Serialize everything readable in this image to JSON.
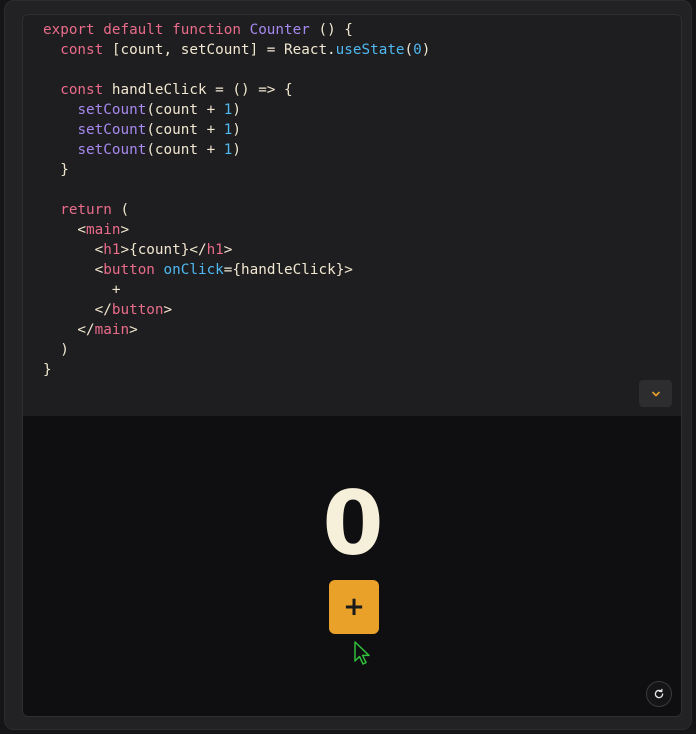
{
  "code": {
    "lines": [
      [
        {
          "t": "kw",
          "v": "export default function "
        },
        {
          "t": "fn",
          "v": "Counter"
        },
        {
          "t": "",
          "v": " () {"
        }
      ],
      [
        {
          "t": "",
          "v": "  "
        },
        {
          "t": "kw",
          "v": "const"
        },
        {
          "t": "",
          "v": " [count, setCount] = React."
        },
        {
          "t": "attr",
          "v": "useState"
        },
        {
          "t": "",
          "v": "("
        },
        {
          "t": "num",
          "v": "0"
        },
        {
          "t": "",
          "v": ")"
        }
      ],
      [],
      [
        {
          "t": "",
          "v": "  "
        },
        {
          "t": "kw",
          "v": "const"
        },
        {
          "t": "",
          "v": " handleClick = () => {"
        }
      ],
      [
        {
          "t": "",
          "v": "    "
        },
        {
          "t": "fn",
          "v": "setCount"
        },
        {
          "t": "",
          "v": "(count + "
        },
        {
          "t": "num",
          "v": "1"
        },
        {
          "t": "",
          "v": ")"
        }
      ],
      [
        {
          "t": "",
          "v": "    "
        },
        {
          "t": "fn",
          "v": "setCount"
        },
        {
          "t": "",
          "v": "(count + "
        },
        {
          "t": "num",
          "v": "1"
        },
        {
          "t": "",
          "v": ")"
        }
      ],
      [
        {
          "t": "",
          "v": "    "
        },
        {
          "t": "fn",
          "v": "setCount"
        },
        {
          "t": "",
          "v": "(count + "
        },
        {
          "t": "num",
          "v": "1"
        },
        {
          "t": "",
          "v": ")"
        }
      ],
      [
        {
          "t": "",
          "v": "  }"
        }
      ],
      [],
      [
        {
          "t": "",
          "v": "  "
        },
        {
          "t": "kw",
          "v": "return"
        },
        {
          "t": "",
          "v": " ("
        }
      ],
      [
        {
          "t": "",
          "v": "    <"
        },
        {
          "t": "tag",
          "v": "main"
        },
        {
          "t": "",
          "v": ">"
        }
      ],
      [
        {
          "t": "",
          "v": "      <"
        },
        {
          "t": "tag",
          "v": "h1"
        },
        {
          "t": "",
          "v": ">{count}</"
        },
        {
          "t": "tag",
          "v": "h1"
        },
        {
          "t": "",
          "v": ">"
        }
      ],
      [
        {
          "t": "",
          "v": "      <"
        },
        {
          "t": "tag",
          "v": "button"
        },
        {
          "t": "",
          "v": " "
        },
        {
          "t": "attr",
          "v": "onClick"
        },
        {
          "t": "",
          "v": "={handleClick}>"
        }
      ],
      [
        {
          "t": "",
          "v": "        +"
        }
      ],
      [
        {
          "t": "",
          "v": "      </"
        },
        {
          "t": "tag",
          "v": "button"
        },
        {
          "t": "",
          "v": ">"
        }
      ],
      [
        {
          "t": "",
          "v": "    </"
        },
        {
          "t": "tag",
          "v": "main"
        },
        {
          "t": "",
          "v": ">"
        }
      ],
      [
        {
          "t": "",
          "v": "  )"
        }
      ],
      [
        {
          "t": "",
          "v": "}"
        }
      ]
    ]
  },
  "preview": {
    "count": "0",
    "button_label": "+"
  },
  "icons": {
    "expand": "chevron-down-icon",
    "refresh": "refresh-icon",
    "cursor": "cursor-arrow-icon"
  },
  "colors": {
    "accent": "#eaa12a",
    "keyword": "#ea6c8a",
    "function": "#a689f0",
    "number": "#4fb8f0",
    "text": "#f1e7d0",
    "cursor": "#2fbf3a"
  }
}
